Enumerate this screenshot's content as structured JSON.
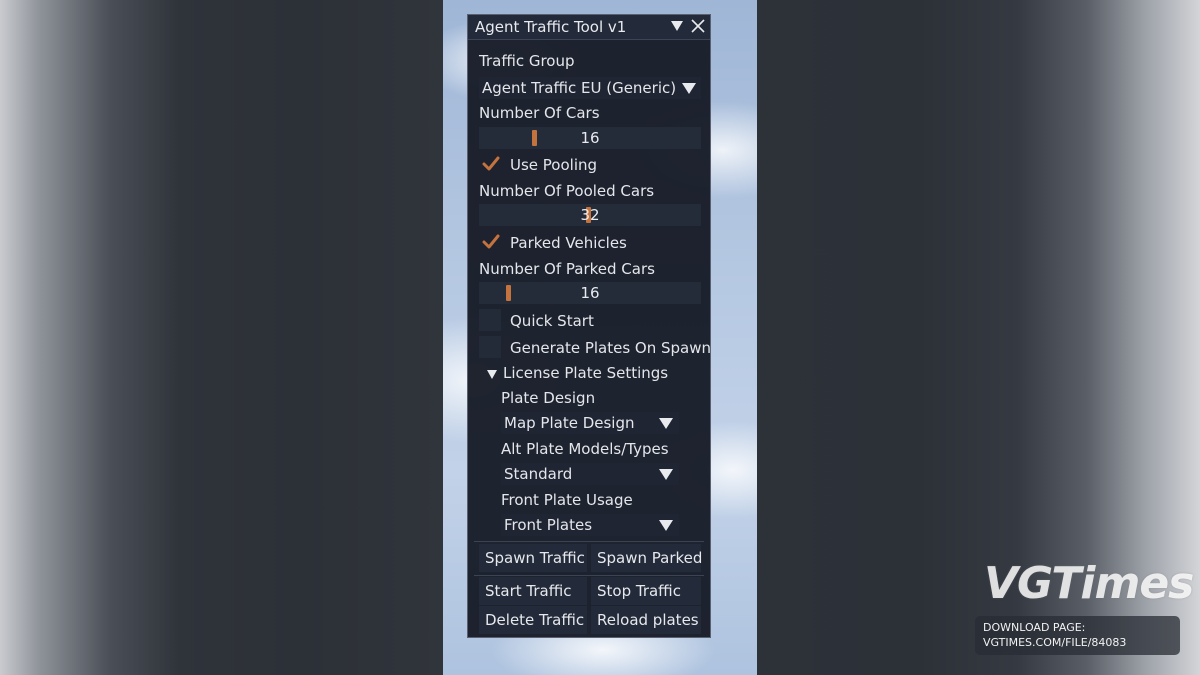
{
  "window": {
    "title": "Agent Traffic Tool v1"
  },
  "traffic_group": {
    "label": "Traffic Group",
    "value": "Agent Traffic EU (Generic)"
  },
  "number_of_cars": {
    "label": "Number Of Cars",
    "value": "16"
  },
  "use_pooling": {
    "label": "Use Pooling",
    "checked": true
  },
  "number_of_pooled_cars": {
    "label": "Number Of Pooled Cars",
    "value": "32"
  },
  "parked_vehicles": {
    "label": "Parked Vehicles",
    "checked": true
  },
  "number_of_parked_cars": {
    "label": "Number Of Parked Cars",
    "value": "16"
  },
  "quick_start": {
    "label": "Quick Start",
    "checked": false
  },
  "generate_plates": {
    "label": "Generate Plates On Spawn",
    "checked": false
  },
  "license_plate_settings": {
    "label": "License Plate Settings",
    "expanded": true,
    "plate_design": {
      "label": "Plate Design",
      "value": "Map Plate Design"
    },
    "alt_plate_models": {
      "label": "Alt Plate Models/Types",
      "value": "Standard"
    },
    "front_plate_usage": {
      "label": "Front Plate Usage",
      "value": "Front Plates"
    }
  },
  "buttons": {
    "spawn_traffic": "Spawn Traffic",
    "spawn_parked": "Spawn Parked",
    "start_traffic": "Start Traffic",
    "stop_traffic": "Stop Traffic",
    "delete_traffic": "Delete Traffic",
    "reload_plates": "Reload plates"
  },
  "watermark": {
    "logo": "VGTimes",
    "line1": "DOWNLOAD PAGE:",
    "line2": "VGTIMES.COM/FILE/84083"
  },
  "colors": {
    "accent": "#c4723e",
    "window_bg": "#181d28",
    "text": "#e4e6ea"
  }
}
